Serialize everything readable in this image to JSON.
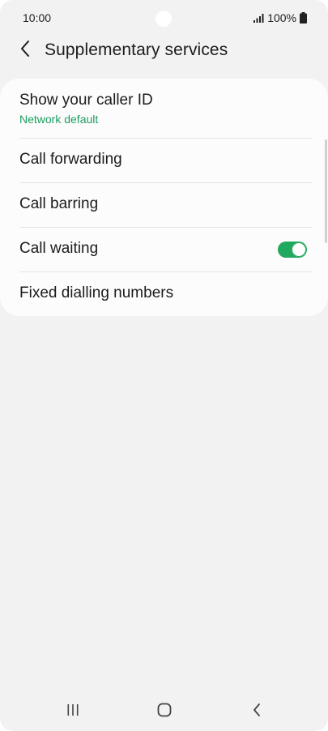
{
  "status_bar": {
    "time": "10:00",
    "battery": "100%",
    "signal_icon": "signal-icon",
    "battery_icon": "battery-icon"
  },
  "header": {
    "back_icon": "chevron-left-icon",
    "title": "Supplementary services"
  },
  "settings": {
    "caller_id": {
      "label": "Show your caller ID",
      "value": "Network default"
    },
    "call_forwarding": {
      "label": "Call forwarding"
    },
    "call_barring": {
      "label": "Call barring"
    },
    "call_waiting": {
      "label": "Call waiting",
      "enabled": true
    },
    "fixed_dialling": {
      "label": "Fixed dialling numbers"
    }
  },
  "nav_bar": {
    "recents_icon": "recents-icon",
    "home_icon": "home-icon",
    "back_icon": "back-icon"
  },
  "colors": {
    "accent": "#1a9e5d",
    "toggle_on": "#21a85f",
    "background": "#f2f2f2",
    "card": "#fcfcfc"
  }
}
